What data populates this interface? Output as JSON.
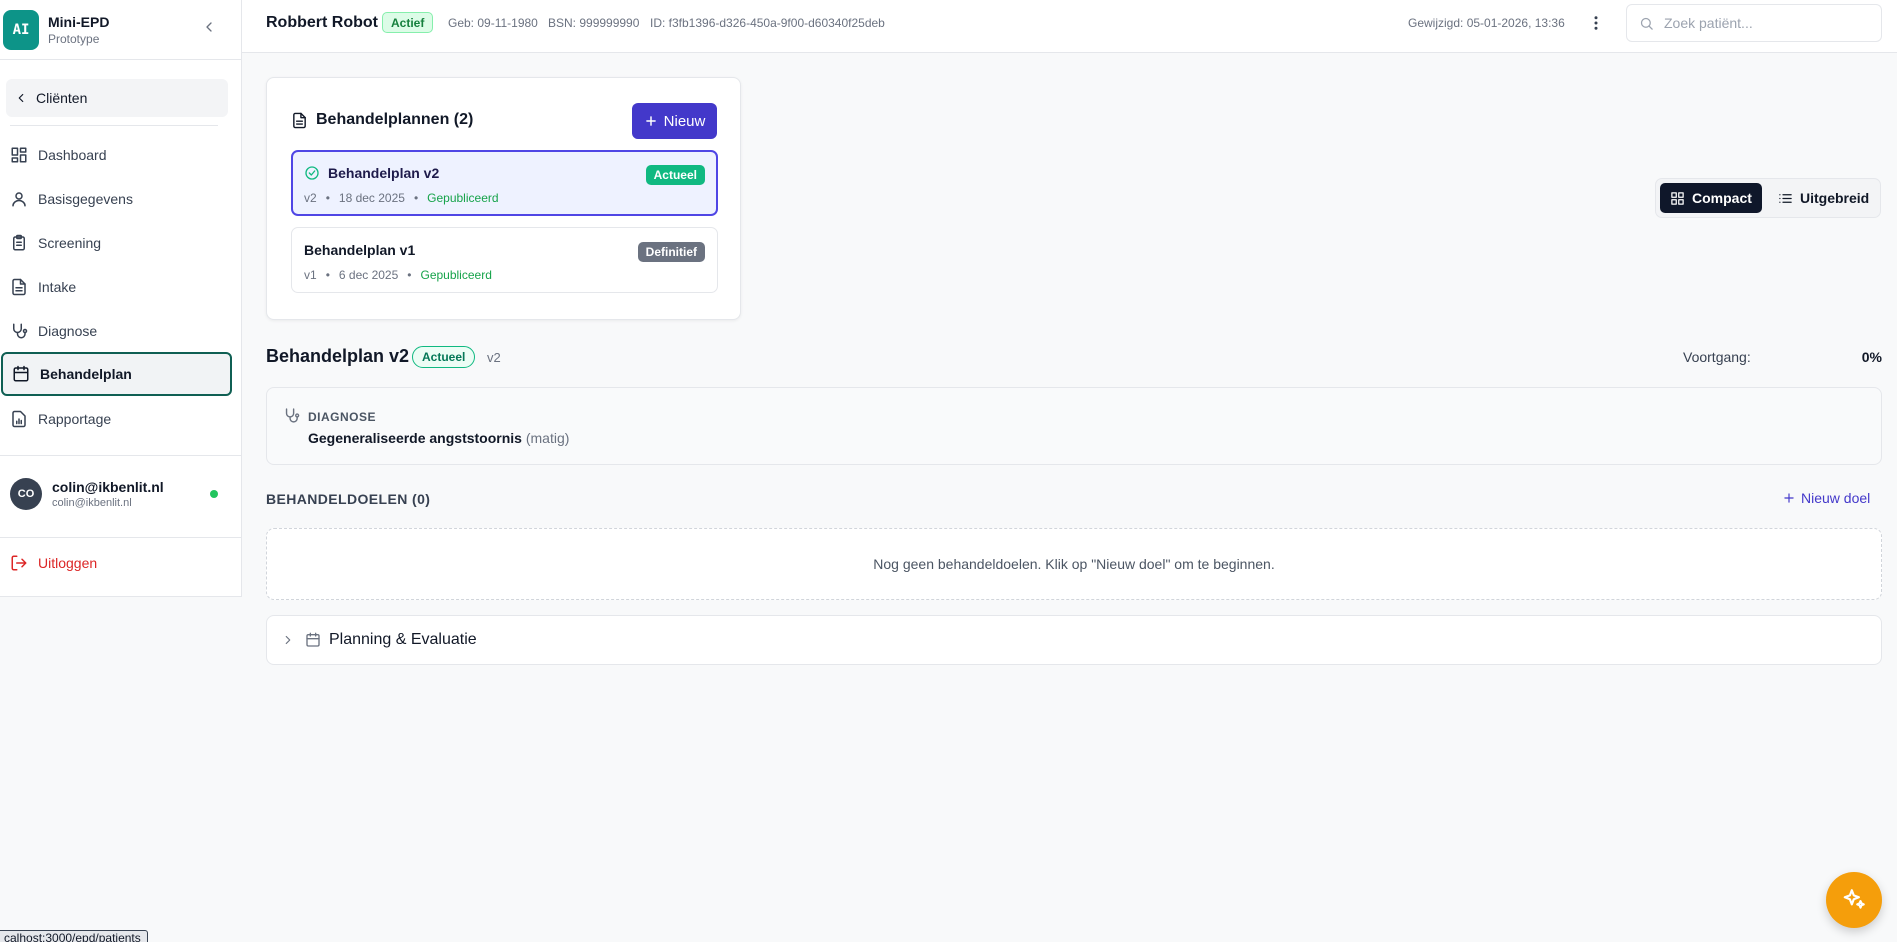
{
  "app": {
    "logo_text": "AI",
    "name": "Mini-EPD",
    "subtitle": "Prototype"
  },
  "sidebar": {
    "back_label": "Cliënten",
    "items": [
      {
        "label": "Dashboard",
        "icon": "dashboard-icon"
      },
      {
        "label": "Basisgegevens",
        "icon": "user-icon"
      },
      {
        "label": "Screening",
        "icon": "clipboard-icon"
      },
      {
        "label": "Intake",
        "icon": "file-text-icon"
      },
      {
        "label": "Diagnose",
        "icon": "stethoscope-icon"
      },
      {
        "label": "Behandelplan",
        "icon": "calendar-icon",
        "active": true
      },
      {
        "label": "Rapportage",
        "icon": "report-chart-icon"
      }
    ],
    "user": {
      "initials": "CO",
      "name": "colin@ikbenlit.nl",
      "email": "colin@ikbenlit.nl",
      "online_color": "#22c55e"
    },
    "logout_label": "Uitloggen"
  },
  "header": {
    "patient_name": "Robbert Robot",
    "status": "Actief",
    "birth": "Geb: 09-11-1980",
    "bsn": "BSN: 999999990",
    "id": "ID: f3fb1396-d326-450a-9f00-d60340f25deb",
    "modified": "Gewijzigd: 05-01-2026, 13:36",
    "search_placeholder": "Zoek patiënt..."
  },
  "plans": {
    "title": "Behandelplannen (2)",
    "new_label": "Nieuw",
    "items": [
      {
        "name": "Behandelplan v2",
        "version": "v2",
        "date": "18 dec 2025",
        "state": "Gepubliceerd",
        "badge": "Actueel",
        "selected": true
      },
      {
        "name": "Behandelplan v1",
        "version": "v1",
        "date": "6 dec 2025",
        "state": "Gepubliceerd",
        "badge": "Definitief",
        "selected": false
      }
    ]
  },
  "view_toggle": {
    "compact_label": "Compact",
    "extended_label": "Uitgebreid"
  },
  "current_plan": {
    "title": "Behandelplan v2",
    "badge": "Actueel",
    "version": "v2",
    "progress_label": "Voortgang:",
    "progress_value": "0%",
    "progress_fraction": 0
  },
  "diagnosis": {
    "label": "DIAGNOSE",
    "value": "Gegeneraliseerde angststoornis",
    "severity": "(matig)"
  },
  "goals": {
    "title": "BEHANDELDOELEN (0)",
    "new_label": "Nieuw doel",
    "empty_text": "Nog geen behandeldoelen. Klik op \"Nieuw doel\" om te beginnen."
  },
  "planning": {
    "title": "Planning & Evaluatie"
  },
  "status_url": "calhost:3000/epd/patients",
  "colors": {
    "brand": "#0d9488",
    "primary": "#4338ca",
    "success": "#10b981",
    "danger": "#dc2626",
    "fab": "#f59e0b"
  }
}
